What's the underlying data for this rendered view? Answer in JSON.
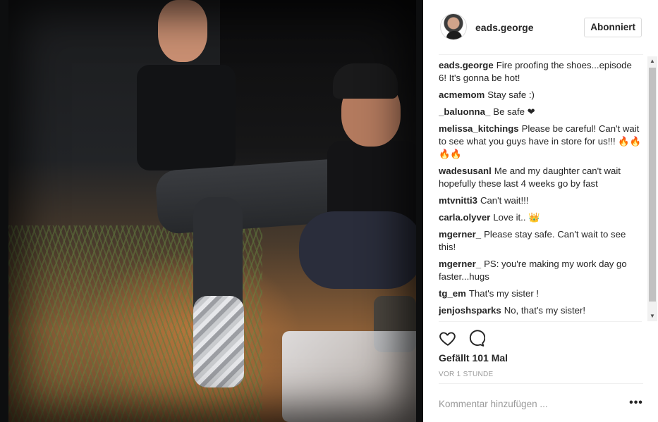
{
  "post": {
    "author": "eads.george",
    "follow_label": "Abonniert"
  },
  "comments": [
    {
      "user": "eads.george",
      "text": "Fire proofing the shoes...episode 6! It's gonna be hot!"
    },
    {
      "user": "acmemom",
      "text": "Stay safe :)"
    },
    {
      "user": "_baluonna_",
      "text": "Be safe ❤"
    },
    {
      "user": "melissa_kitchings",
      "text": "Please be careful! Can't wait to see what you guys have in store for us!!! 🔥🔥🔥🔥"
    },
    {
      "user": "wadesusanl",
      "text": "Me and my daughter can't wait hopefully these last 4 weeks go by fast"
    },
    {
      "user": "mtvnitti3",
      "text": "Can't wait!!!"
    },
    {
      "user": "carla.olyver",
      "text": "Love it.. 👑"
    },
    {
      "user": "mgerner_",
      "text": "Please stay safe. Can't wait to see this!"
    },
    {
      "user": "mgerner_",
      "text": "PS: you're making my work day go faster...hugs"
    },
    {
      "user": "tg_em",
      "text": "That's my sister !"
    },
    {
      "user": "jenjoshsparks",
      "text": "No, that's my sister!"
    }
  ],
  "actions": {
    "like_icon": "heart-outline-icon",
    "comment_icon": "speech-bubble-icon"
  },
  "likes_text": "Gefällt 101 Mal",
  "time_text": "VOR 1 STUNDE",
  "add_comment": {
    "placeholder": "Kommentar hinzufügen ...",
    "more_label": "•••"
  },
  "scrollbar": {
    "up_glyph": "▲",
    "down_glyph": "▼"
  }
}
